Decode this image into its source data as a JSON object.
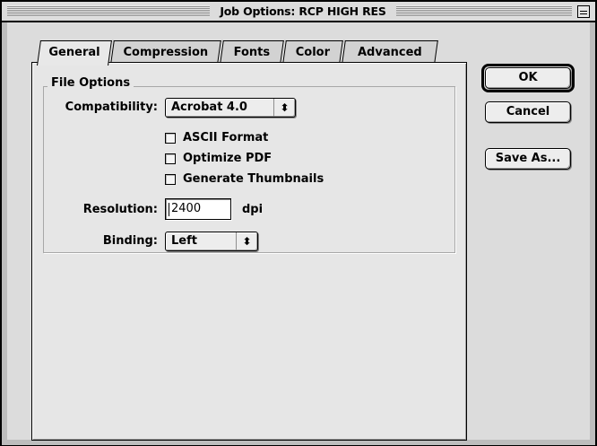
{
  "window": {
    "title": "Job Options: RCP HIGH RES"
  },
  "tabs": [
    {
      "label": "General",
      "active": true
    },
    {
      "label": "Compression",
      "active": false
    },
    {
      "label": "Fonts",
      "active": false
    },
    {
      "label": "Color",
      "active": false
    },
    {
      "label": "Advanced",
      "active": false
    }
  ],
  "file_options": {
    "group_label": "File Options",
    "compatibility_label": "Compatibility:",
    "compatibility_value": "Acrobat 4.0",
    "checkboxes": [
      {
        "label": "ASCII Format",
        "checked": false
      },
      {
        "label": "Optimize PDF",
        "checked": false
      },
      {
        "label": "Generate Thumbnails",
        "checked": false
      }
    ],
    "resolution_label": "Resolution:",
    "resolution_value": "2400",
    "resolution_unit": "dpi",
    "binding_label": "Binding:",
    "binding_value": "Left"
  },
  "buttons": {
    "ok": "OK",
    "cancel": "Cancel",
    "save_as": "Save As..."
  },
  "icons": {
    "popup_arrows": "updown-arrows-icon",
    "collapse": "collapse-box-icon"
  },
  "colors": {
    "window_bg": "#dcdcdc",
    "panel_bg": "#e6e6e6"
  }
}
